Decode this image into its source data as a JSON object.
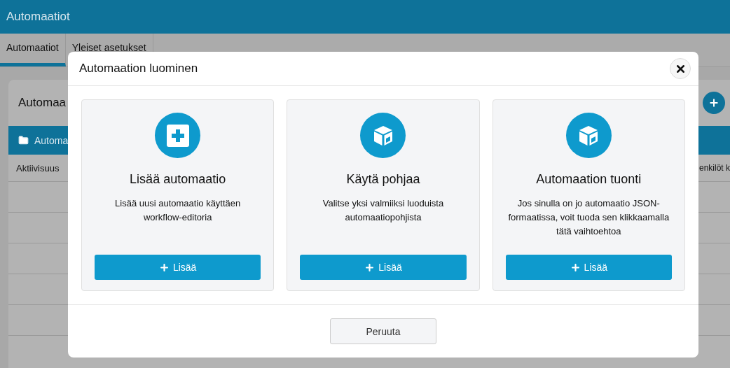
{
  "app_bar": {
    "title": "Automaatiot"
  },
  "tabs": [
    {
      "label": "Automaatiot",
      "selected": true
    },
    {
      "label": "Yleiset asetukset",
      "selected": false
    }
  ],
  "panel": {
    "title": "Automaa",
    "folder_row": {
      "label": "Automa"
    },
    "columns": [
      "Aktiivisuus",
      "enkilöt k"
    ]
  },
  "dialog": {
    "title": "Automaation luominen",
    "options": [
      {
        "kind": "add",
        "title": "Lisää automaatio",
        "description": "Lisää uusi automaatio käyttäen\nworkflow-editoria",
        "button": "Lisää"
      },
      {
        "kind": "template",
        "title": "Käytä pohjaa",
        "description": "Valitse yksi valmiiksi luoduista\nautomaatiopohjista",
        "button": "Lisää"
      },
      {
        "kind": "import",
        "title": "Automaation tuonti",
        "description": "Jos sinulla on jo automaatio JSON-\nformaatissa, voit tuoda sen klikkaamalla\ntätä vaihtoehtoa",
        "button": "Lisää"
      }
    ],
    "cancel_button": "Peruuta"
  }
}
